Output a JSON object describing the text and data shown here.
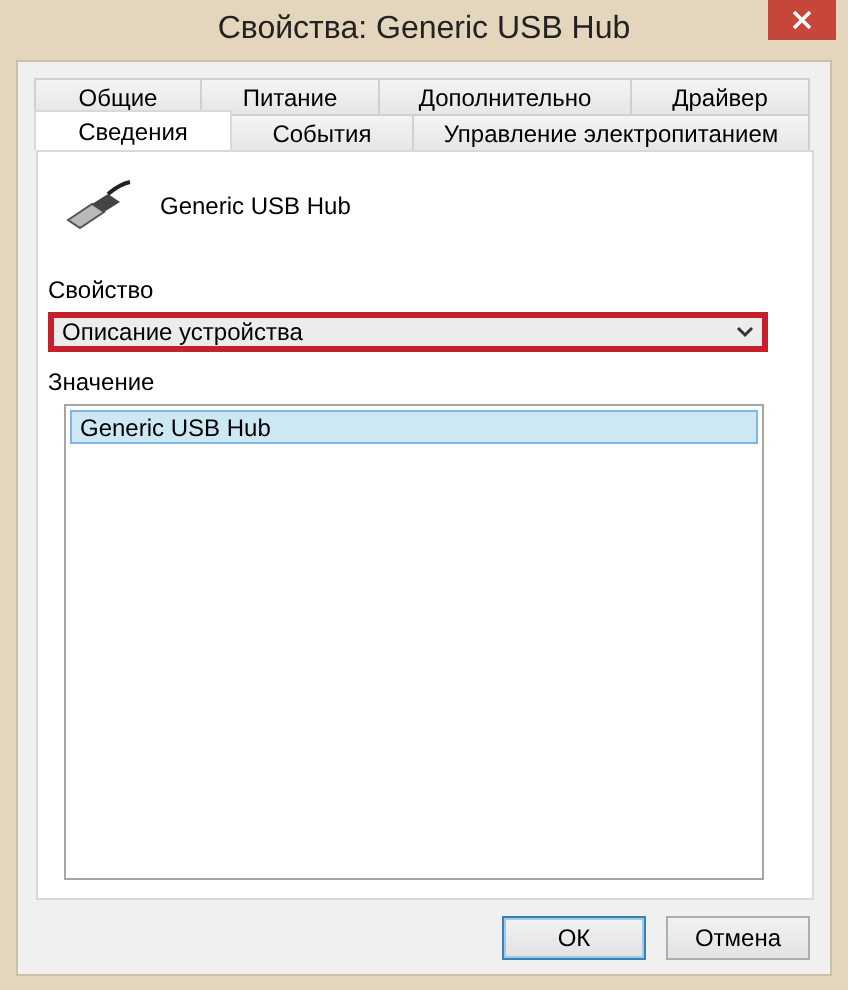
{
  "window": {
    "title": "Свойства: Generic USB Hub"
  },
  "tabs": {
    "back_row": [
      {
        "label": "Общие",
        "selected": false
      },
      {
        "label": "Питание",
        "selected": false
      },
      {
        "label": "Дополнительно",
        "selected": false
      },
      {
        "label": "Драйвер",
        "selected": false
      }
    ],
    "front_row": [
      {
        "label": "Сведения",
        "selected": true
      },
      {
        "label": "События",
        "selected": false
      },
      {
        "label": "Управление электропитанием",
        "selected": false
      }
    ]
  },
  "device": {
    "name": "Generic USB Hub"
  },
  "property": {
    "label": "Свойство",
    "value": "Описание устройства",
    "highlighted": true
  },
  "value": {
    "label": "Значение",
    "items": [
      {
        "text": "Generic USB Hub",
        "selected": true
      }
    ]
  },
  "buttons": [
    {
      "label": "ОК",
      "focused": true
    },
    {
      "label": "Отмена",
      "focused": false
    }
  ]
}
